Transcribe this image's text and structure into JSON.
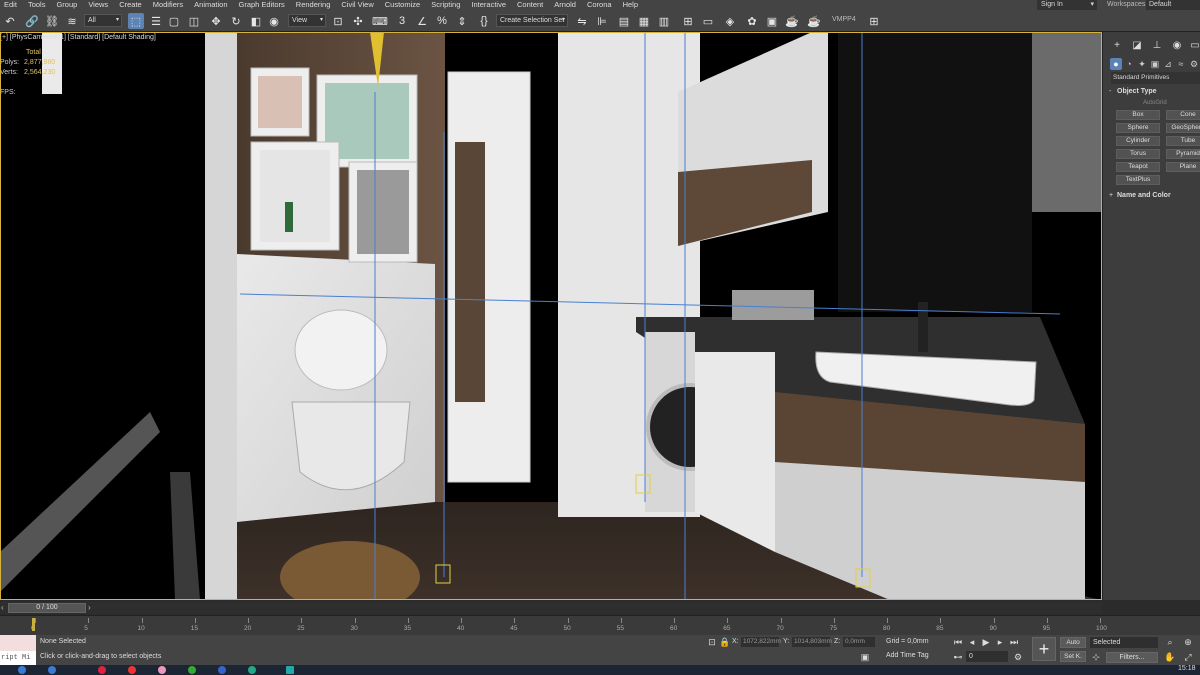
{
  "menu": [
    "Edit",
    "Tools",
    "Group",
    "Views",
    "Create",
    "Modifiers",
    "Animation",
    "Graph Editors",
    "Rendering",
    "Civil View",
    "Customize",
    "Scripting",
    "Interactive",
    "Content",
    "Arnold",
    "Corona",
    "Help"
  ],
  "account": {
    "signin": "Sign In",
    "workspaces_label": "Workspaces:",
    "workspace": "Default"
  },
  "toolbar": {
    "filter": "All",
    "ref_coord": "View",
    "selection_set": "Create Selection Set",
    "vmp_label": "VMPP4",
    "icons": [
      "undo-icon",
      "redo-icon",
      "link-icon",
      "unlink-icon",
      "bind-spacewarp-icon",
      "select-object-icon",
      "select-by-name-icon",
      "rect-region-icon",
      "window-crossing-icon",
      "move-icon",
      "rotate-icon",
      "scale-icon",
      "select-manipulate-icon",
      "keyboard-shortcut-icon",
      "snaps-3d-icon",
      "angle-snap-icon",
      "percent-snap-icon",
      "spinner-snap-icon",
      "edit-named-sel-icon",
      "mirror-icon",
      "align-icon",
      "layer-explorer-icon",
      "toggle-ribbon-icon",
      "curve-editor-icon",
      "schematic-view-icon",
      "material-editor-icon",
      "render-setup-icon",
      "rendered-frame-icon",
      "render-icon",
      "teapot-icon",
      "viewport-layout-icon"
    ]
  },
  "viewport": {
    "label": "[+] [PhysCamera001] [Standard] [Default Shading]",
    "stats": {
      "total_label": "Total",
      "polys_label": "Polys:",
      "polys": "2,877,880",
      "verts_label": "Verts:",
      "verts": "2,564,230",
      "fps_label": "FPS:"
    }
  },
  "command_panel": {
    "category": "Standard Primitives",
    "object_type_title": "Object Type",
    "autogrid": "AutoGrid",
    "primitives": [
      "Box",
      "Cone",
      "Sphere",
      "GeoSphere",
      "Cylinder",
      "Tube",
      "Torus",
      "Pyramid",
      "Teapot",
      "Plane",
      "TextPlus"
    ],
    "name_color_title": "Name and Color"
  },
  "timeline": {
    "position": "0 / 100",
    "ticks": [
      0,
      5,
      10,
      15,
      20,
      25,
      30,
      35,
      40,
      45,
      50,
      55,
      60,
      65,
      70,
      75,
      80,
      85,
      90,
      95,
      100
    ]
  },
  "status": {
    "maxscript": "ript Mi",
    "selection": "None Selected",
    "prompt": "Click or click-and-drag to select objects",
    "x_label": "X:",
    "x_value": "1072,822mm",
    "y_label": "Y:",
    "y_value": "1014,803mm",
    "z_label": "Z:",
    "z_value": "0,0mm",
    "grid": "Grid = 0,0mm",
    "add_time_tag": "Add Time Tag",
    "frame": "0",
    "auto_key": "Auto",
    "set_key": "Set K.",
    "key_mode": "Selected",
    "filters": "Filters..."
  },
  "taskbar": {
    "clock": "15:18"
  }
}
